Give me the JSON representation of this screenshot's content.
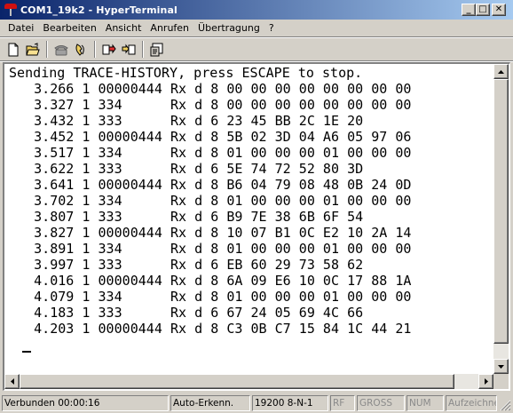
{
  "window": {
    "title": "COM1_19k2 - HyperTerminal",
    "minimize_label": "_",
    "maximize_label": "□",
    "close_label": "✕"
  },
  "menu": [
    {
      "label": "Datei"
    },
    {
      "label": "Bearbeiten"
    },
    {
      "label": "Ansicht"
    },
    {
      "label": "Anrufen"
    },
    {
      "label": "Übertragung"
    },
    {
      "label": "?"
    }
  ],
  "toolbar": {
    "buttons": [
      {
        "icon": "new-document-icon"
      },
      {
        "icon": "open-folder-icon"
      },
      {
        "icon": "connect-phone-icon"
      },
      {
        "icon": "disconnect-phone-icon"
      },
      {
        "icon": "send-file-icon"
      },
      {
        "icon": "receive-file-icon"
      },
      {
        "icon": "properties-icon"
      }
    ]
  },
  "terminal": {
    "header": "Sending TRACE-HISTORY, press ESCAPE to stop.",
    "lines": [
      "  3.266 1 00000444 Rx d 8 00 00 00 00 00 00 00 00",
      "  3.327 1 334      Rx d 8 00 00 00 00 00 00 00 00",
      "  3.432 1 333      Rx d 6 23 45 BB 2C 1E 20",
      "  3.452 1 00000444 Rx d 8 5B 02 3D 04 A6 05 97 06",
      "  3.517 1 334      Rx d 8 01 00 00 00 01 00 00 00",
      "  3.622 1 333      Rx d 6 5E 74 72 52 80 3D",
      "  3.641 1 00000444 Rx d 8 B6 04 79 08 48 0B 24 0D",
      "  3.702 1 334      Rx d 8 01 00 00 00 01 00 00 00",
      "  3.807 1 333      Rx d 6 B9 7E 38 6B 6F 54",
      "  3.827 1 00000444 Rx d 8 10 07 B1 0C E2 10 2A 14",
      "  3.891 1 334      Rx d 8 01 00 00 00 01 00 00 00",
      "  3.997 1 333      Rx d 6 EB 60 29 73 58 62",
      "  4.016 1 00000444 Rx d 8 6A 09 E6 10 0C 17 88 1A",
      "  4.079 1 334      Rx d 8 01 00 00 00 01 00 00 00",
      "  4.183 1 333      Rx d 6 67 24 05 69 4C 66",
      "  4.203 1 00000444 Rx d 8 C3 0B C7 15 84 1C 44 21"
    ]
  },
  "status": {
    "connected": "Verbunden 00:00:16",
    "detect": "Auto-Erkenn.",
    "settings": "19200 8-N-1",
    "rf": "RF",
    "caps": "GROSS",
    "num": "NUM",
    "capture": "Aufzeichnen"
  }
}
